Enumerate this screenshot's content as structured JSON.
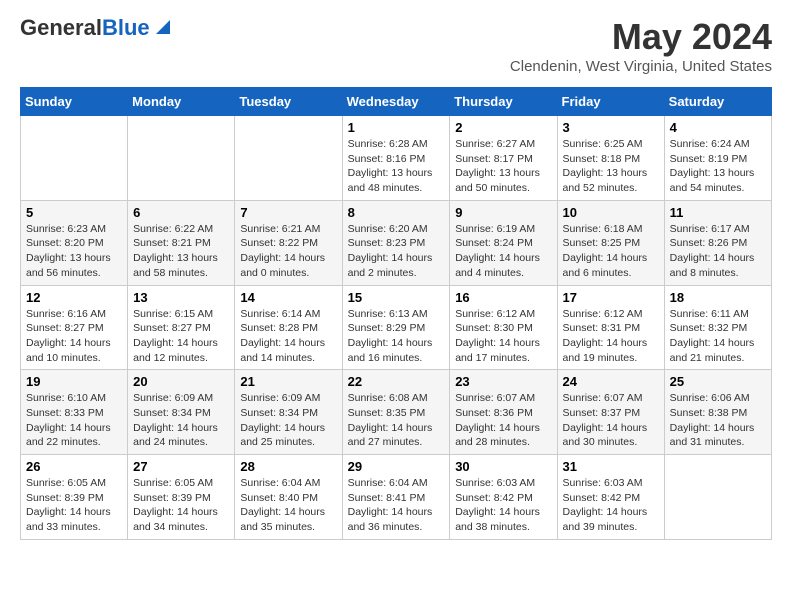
{
  "header": {
    "logo_line1": "General",
    "logo_line2": "Blue",
    "month": "May 2024",
    "location": "Clendenin, West Virginia, United States"
  },
  "weekdays": [
    "Sunday",
    "Monday",
    "Tuesday",
    "Wednesday",
    "Thursday",
    "Friday",
    "Saturday"
  ],
  "weeks": [
    [
      {
        "day": "",
        "info": ""
      },
      {
        "day": "",
        "info": ""
      },
      {
        "day": "",
        "info": ""
      },
      {
        "day": "1",
        "info": "Sunrise: 6:28 AM\nSunset: 8:16 PM\nDaylight: 13 hours\nand 48 minutes."
      },
      {
        "day": "2",
        "info": "Sunrise: 6:27 AM\nSunset: 8:17 PM\nDaylight: 13 hours\nand 50 minutes."
      },
      {
        "day": "3",
        "info": "Sunrise: 6:25 AM\nSunset: 8:18 PM\nDaylight: 13 hours\nand 52 minutes."
      },
      {
        "day": "4",
        "info": "Sunrise: 6:24 AM\nSunset: 8:19 PM\nDaylight: 13 hours\nand 54 minutes."
      }
    ],
    [
      {
        "day": "5",
        "info": "Sunrise: 6:23 AM\nSunset: 8:20 PM\nDaylight: 13 hours\nand 56 minutes."
      },
      {
        "day": "6",
        "info": "Sunrise: 6:22 AM\nSunset: 8:21 PM\nDaylight: 13 hours\nand 58 minutes."
      },
      {
        "day": "7",
        "info": "Sunrise: 6:21 AM\nSunset: 8:22 PM\nDaylight: 14 hours\nand 0 minutes."
      },
      {
        "day": "8",
        "info": "Sunrise: 6:20 AM\nSunset: 8:23 PM\nDaylight: 14 hours\nand 2 minutes."
      },
      {
        "day": "9",
        "info": "Sunrise: 6:19 AM\nSunset: 8:24 PM\nDaylight: 14 hours\nand 4 minutes."
      },
      {
        "day": "10",
        "info": "Sunrise: 6:18 AM\nSunset: 8:25 PM\nDaylight: 14 hours\nand 6 minutes."
      },
      {
        "day": "11",
        "info": "Sunrise: 6:17 AM\nSunset: 8:26 PM\nDaylight: 14 hours\nand 8 minutes."
      }
    ],
    [
      {
        "day": "12",
        "info": "Sunrise: 6:16 AM\nSunset: 8:27 PM\nDaylight: 14 hours\nand 10 minutes."
      },
      {
        "day": "13",
        "info": "Sunrise: 6:15 AM\nSunset: 8:27 PM\nDaylight: 14 hours\nand 12 minutes."
      },
      {
        "day": "14",
        "info": "Sunrise: 6:14 AM\nSunset: 8:28 PM\nDaylight: 14 hours\nand 14 minutes."
      },
      {
        "day": "15",
        "info": "Sunrise: 6:13 AM\nSunset: 8:29 PM\nDaylight: 14 hours\nand 16 minutes."
      },
      {
        "day": "16",
        "info": "Sunrise: 6:12 AM\nSunset: 8:30 PM\nDaylight: 14 hours\nand 17 minutes."
      },
      {
        "day": "17",
        "info": "Sunrise: 6:12 AM\nSunset: 8:31 PM\nDaylight: 14 hours\nand 19 minutes."
      },
      {
        "day": "18",
        "info": "Sunrise: 6:11 AM\nSunset: 8:32 PM\nDaylight: 14 hours\nand 21 minutes."
      }
    ],
    [
      {
        "day": "19",
        "info": "Sunrise: 6:10 AM\nSunset: 8:33 PM\nDaylight: 14 hours\nand 22 minutes."
      },
      {
        "day": "20",
        "info": "Sunrise: 6:09 AM\nSunset: 8:34 PM\nDaylight: 14 hours\nand 24 minutes."
      },
      {
        "day": "21",
        "info": "Sunrise: 6:09 AM\nSunset: 8:34 PM\nDaylight: 14 hours\nand 25 minutes."
      },
      {
        "day": "22",
        "info": "Sunrise: 6:08 AM\nSunset: 8:35 PM\nDaylight: 14 hours\nand 27 minutes."
      },
      {
        "day": "23",
        "info": "Sunrise: 6:07 AM\nSunset: 8:36 PM\nDaylight: 14 hours\nand 28 minutes."
      },
      {
        "day": "24",
        "info": "Sunrise: 6:07 AM\nSunset: 8:37 PM\nDaylight: 14 hours\nand 30 minutes."
      },
      {
        "day": "25",
        "info": "Sunrise: 6:06 AM\nSunset: 8:38 PM\nDaylight: 14 hours\nand 31 minutes."
      }
    ],
    [
      {
        "day": "26",
        "info": "Sunrise: 6:05 AM\nSunset: 8:39 PM\nDaylight: 14 hours\nand 33 minutes."
      },
      {
        "day": "27",
        "info": "Sunrise: 6:05 AM\nSunset: 8:39 PM\nDaylight: 14 hours\nand 34 minutes."
      },
      {
        "day": "28",
        "info": "Sunrise: 6:04 AM\nSunset: 8:40 PM\nDaylight: 14 hours\nand 35 minutes."
      },
      {
        "day": "29",
        "info": "Sunrise: 6:04 AM\nSunset: 8:41 PM\nDaylight: 14 hours\nand 36 minutes."
      },
      {
        "day": "30",
        "info": "Sunrise: 6:03 AM\nSunset: 8:42 PM\nDaylight: 14 hours\nand 38 minutes."
      },
      {
        "day": "31",
        "info": "Sunrise: 6:03 AM\nSunset: 8:42 PM\nDaylight: 14 hours\nand 39 minutes."
      },
      {
        "day": "",
        "info": ""
      }
    ]
  ]
}
